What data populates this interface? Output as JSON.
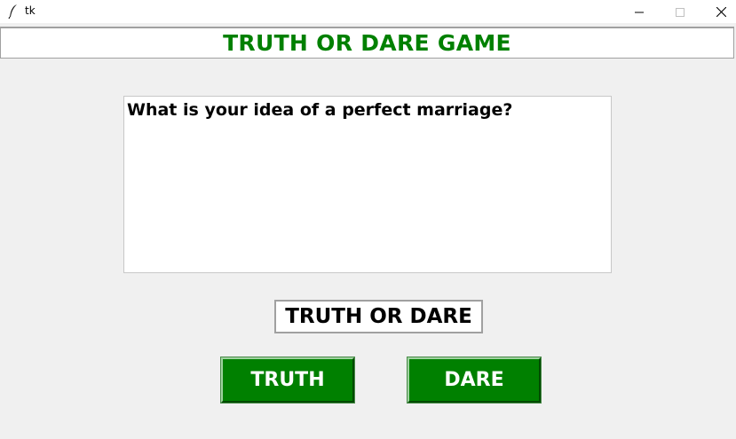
{
  "window": {
    "title": "tk",
    "app_icon": "feather-icon",
    "controls": [
      "minimize-icon",
      "maximize-icon",
      "close-icon"
    ]
  },
  "header": {
    "title": "TRUTH OR DARE GAME",
    "color": "#008000"
  },
  "question": {
    "text": "What is your idea of a perfect marriage?"
  },
  "mode_label": {
    "text": "TRUTH OR DARE"
  },
  "buttons": {
    "truth_label": "TRUTH",
    "dare_label": "DARE",
    "background": "#008000",
    "text_color": "#ffffff"
  }
}
